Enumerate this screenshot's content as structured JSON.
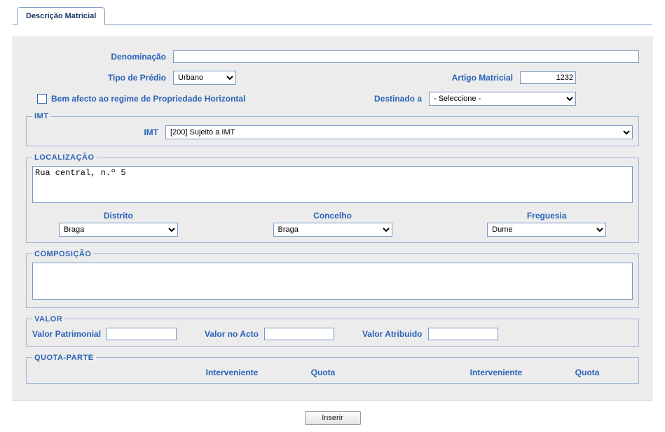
{
  "tab": {
    "label": "Descrição Matricial"
  },
  "form": {
    "denominacao": {
      "label": "Denominação",
      "value": ""
    },
    "tipo_predio": {
      "label": "Tipo de Prédio",
      "selected": "Urbano"
    },
    "artigo_matricial": {
      "label": "Artigo Matricial",
      "value": "1232"
    },
    "bem_afecto": {
      "label": "Bem afecto ao regime de Propriedade Horizontal",
      "checked": false
    },
    "destinado_a": {
      "label": "Destinado a",
      "selected": "- Seleccione -"
    }
  },
  "imt": {
    "legend": "IMT",
    "label": "IMT",
    "selected": "[200] Sujeito a IMT"
  },
  "localizacao": {
    "legend": "LOCALIZAÇÃO",
    "address": "Rua central, n.º 5",
    "distrito": {
      "label": "Distrito",
      "selected": "Braga"
    },
    "concelho": {
      "label": "Concelho",
      "selected": "Braga"
    },
    "freguesia": {
      "label": "Freguesia",
      "selected": "Dume"
    }
  },
  "composicao": {
    "legend": "COMPOSIÇÃO",
    "value": ""
  },
  "valor": {
    "legend": "VALOR",
    "patrimonial": {
      "label": "Valor Patrimonial",
      "value": ""
    },
    "no_acto": {
      "label": "Valor no Acto",
      "value": ""
    },
    "atribuido": {
      "label": "Valor Atribuido",
      "value": ""
    }
  },
  "quota_parte": {
    "legend": "QUOTA-PARTE",
    "col_interveniente": "Interveniente",
    "col_quota": "Quota"
  },
  "actions": {
    "inserir": "Inserir"
  }
}
